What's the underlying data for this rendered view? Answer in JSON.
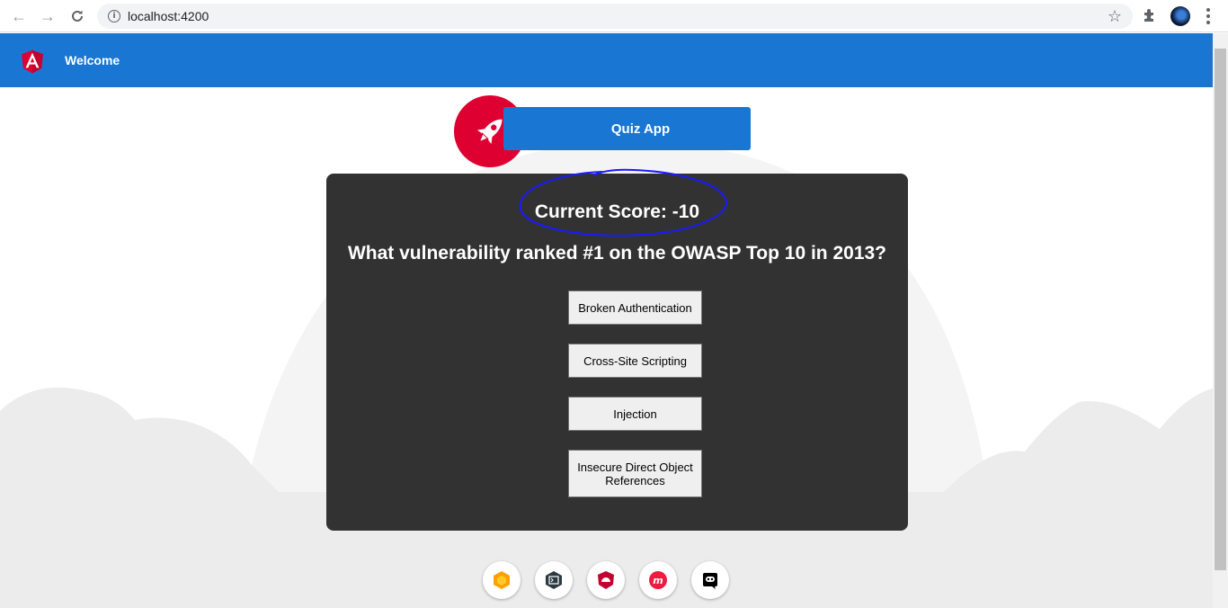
{
  "browser": {
    "url": "localhost:4200"
  },
  "toolbar": {
    "title": "Welcome"
  },
  "banner": {
    "title": "Quiz App"
  },
  "quiz": {
    "score_text": "Current Score: -10",
    "question": "What vulnerability ranked #1 on the OWASP Top 10 in 2013?",
    "answers": [
      "Broken Authentication",
      "Cross-Site Scripting",
      "Injection",
      "Insecure Direct Object References"
    ]
  },
  "footer": {
    "icons": [
      "firebase-icon",
      "terminal-icon",
      "angular-material-icon",
      "meetup-icon",
      "discord-icon"
    ]
  },
  "colors": {
    "toolbar": "#1976d2",
    "rocket_circle": "#dd0031",
    "card": "#323232",
    "annotation": "#1a1aff"
  }
}
